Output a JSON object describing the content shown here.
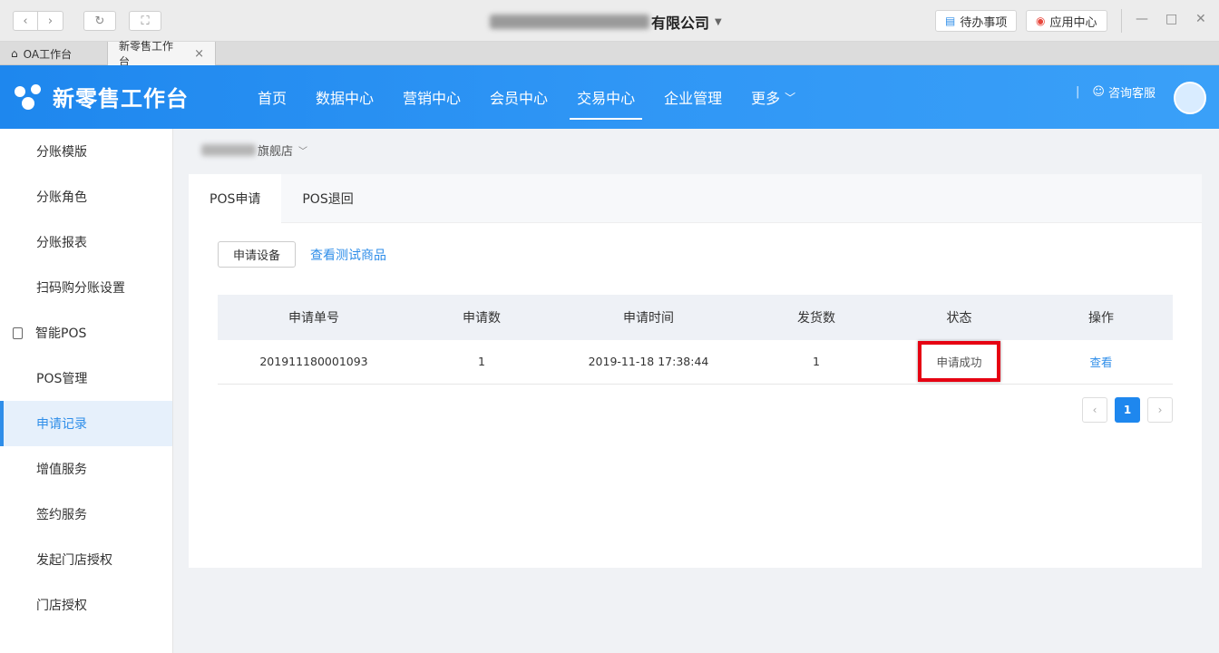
{
  "window": {
    "title_suffix": "有限公司",
    "todo_label": "待办事项",
    "app_center_label": "应用中心"
  },
  "browser_tabs": [
    {
      "label": "OA工作台",
      "icon": "home-icon"
    },
    {
      "label": "新零售工作台",
      "active": true
    }
  ],
  "header": {
    "app_name": "新零售工作台",
    "nav": [
      "首页",
      "数据中心",
      "营销中心",
      "会员中心",
      "交易中心",
      "企业管理",
      "更多"
    ],
    "active_nav": "交易中心",
    "consult_label": "咨询客服"
  },
  "sidebar": {
    "items": [
      "分账模版",
      "分账角色",
      "分账报表",
      "扫码购分账设置"
    ],
    "group_label": "智能POS",
    "group_items": [
      "POS管理",
      "申请记录",
      "增值服务",
      "签约服务",
      "发起门店授权",
      "门店授权"
    ],
    "active_item": "申请记录"
  },
  "store": {
    "name_suffix": "旗舰店"
  },
  "tabs": [
    "POS申请",
    "POS退回"
  ],
  "actions": {
    "apply_button": "申请设备",
    "test_goods_link": "查看测试商品"
  },
  "table": {
    "columns": [
      "申请单号",
      "申请数",
      "申请时间",
      "发货数",
      "状态",
      "操作"
    ],
    "rows": [
      {
        "order_no": "201911180001093",
        "count": "1",
        "time": "2019-11-18 17:38:44",
        "shipped": "1",
        "status": "申请成功",
        "action": "查看"
      }
    ]
  },
  "pagination": {
    "prev": "‹",
    "current": "1",
    "next": "›"
  },
  "colors": {
    "primary": "#1e87ee",
    "highlight_border": "#e60012"
  }
}
